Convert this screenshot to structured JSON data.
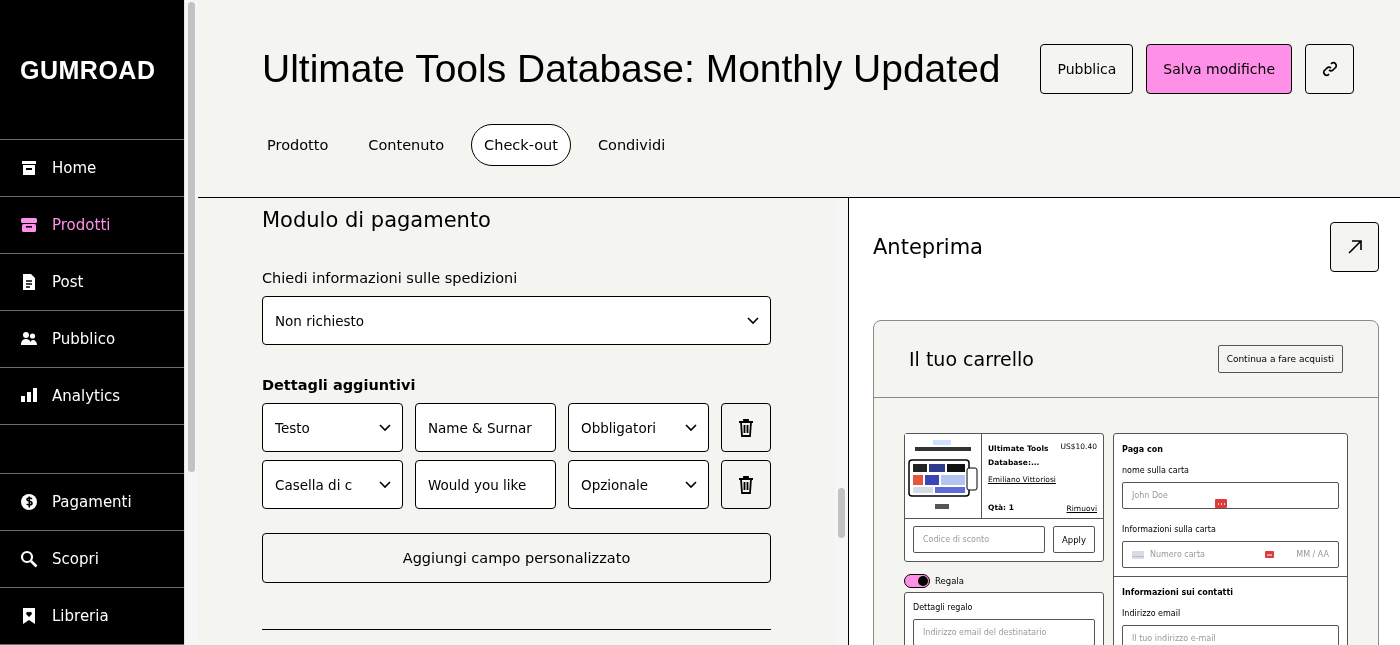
{
  "sidebar": {
    "logo": "GUMROAD",
    "items": [
      {
        "label": "Home",
        "selected": false
      },
      {
        "label": "Prodotti",
        "selected": true
      },
      {
        "label": "Post",
        "selected": false
      },
      {
        "label": "Pubblico",
        "selected": false
      },
      {
        "label": "Analytics",
        "selected": false
      }
    ],
    "bottom_items": [
      {
        "label": "Pagamenti",
        "selected": false
      },
      {
        "label": "Scopri",
        "selected": false
      },
      {
        "label": "Libreria",
        "selected": false
      }
    ]
  },
  "header": {
    "title": "Ultimate Tools Database: Monthly Updated",
    "buttons": [
      {
        "label": "Pubblica",
        "kind": "outline"
      },
      {
        "label": "Salva modifiche",
        "kind": "primary"
      }
    ],
    "tabs": [
      {
        "label": "Prodotto",
        "selected": false
      },
      {
        "label": "Contenuto",
        "selected": false
      },
      {
        "label": "Check-out",
        "selected": true
      },
      {
        "label": "Condividi",
        "selected": false
      }
    ]
  },
  "form": {
    "title": "Modulo di pagamento",
    "shipping_label": "Chiedi informazioni sulle spedizioni",
    "shipping_value": "Non richiesto",
    "extra_title": "Dettagli aggiuntivi",
    "extra_rows": [
      {
        "type": "Testo",
        "label": "Name & Surnar",
        "requirement": "Obbligatori"
      },
      {
        "type": "Casella di c",
        "label": "Would you like",
        "requirement": "Opzionale"
      }
    ],
    "add_button": "Aggiungi campo personalizzato"
  },
  "preview": {
    "title": "Anteprima",
    "cart_title": "Il tuo carrello",
    "continue_button": "Continua a fare acquisti",
    "product": {
      "name": "Ultimate Tools Database:...",
      "price": "US$10.40",
      "author": "Emiliano Vittoriosi",
      "quantity": "Qtà: 1",
      "remove": "Rimuovi"
    },
    "discount_placeholder": "Codice di sconto",
    "apply_button": "Apply",
    "gift": {
      "label": "Regala",
      "on": true,
      "title": "Dettagli regalo",
      "placeholder": "Indirizzo email del destinatario"
    },
    "payment": {
      "title": "Paga con",
      "name_label": "nome sulla carta",
      "name_placeholder": "John Doe",
      "card_label": "Informazioni sulla carta",
      "card_placeholder": "Numero carta",
      "expiry_placeholder": "MM / AA"
    },
    "contact": {
      "title": "Informazioni sui contatti",
      "email_label": "Indirizzo email",
      "email_placeholder": "Il tuo indirizzo e-mail"
    }
  }
}
